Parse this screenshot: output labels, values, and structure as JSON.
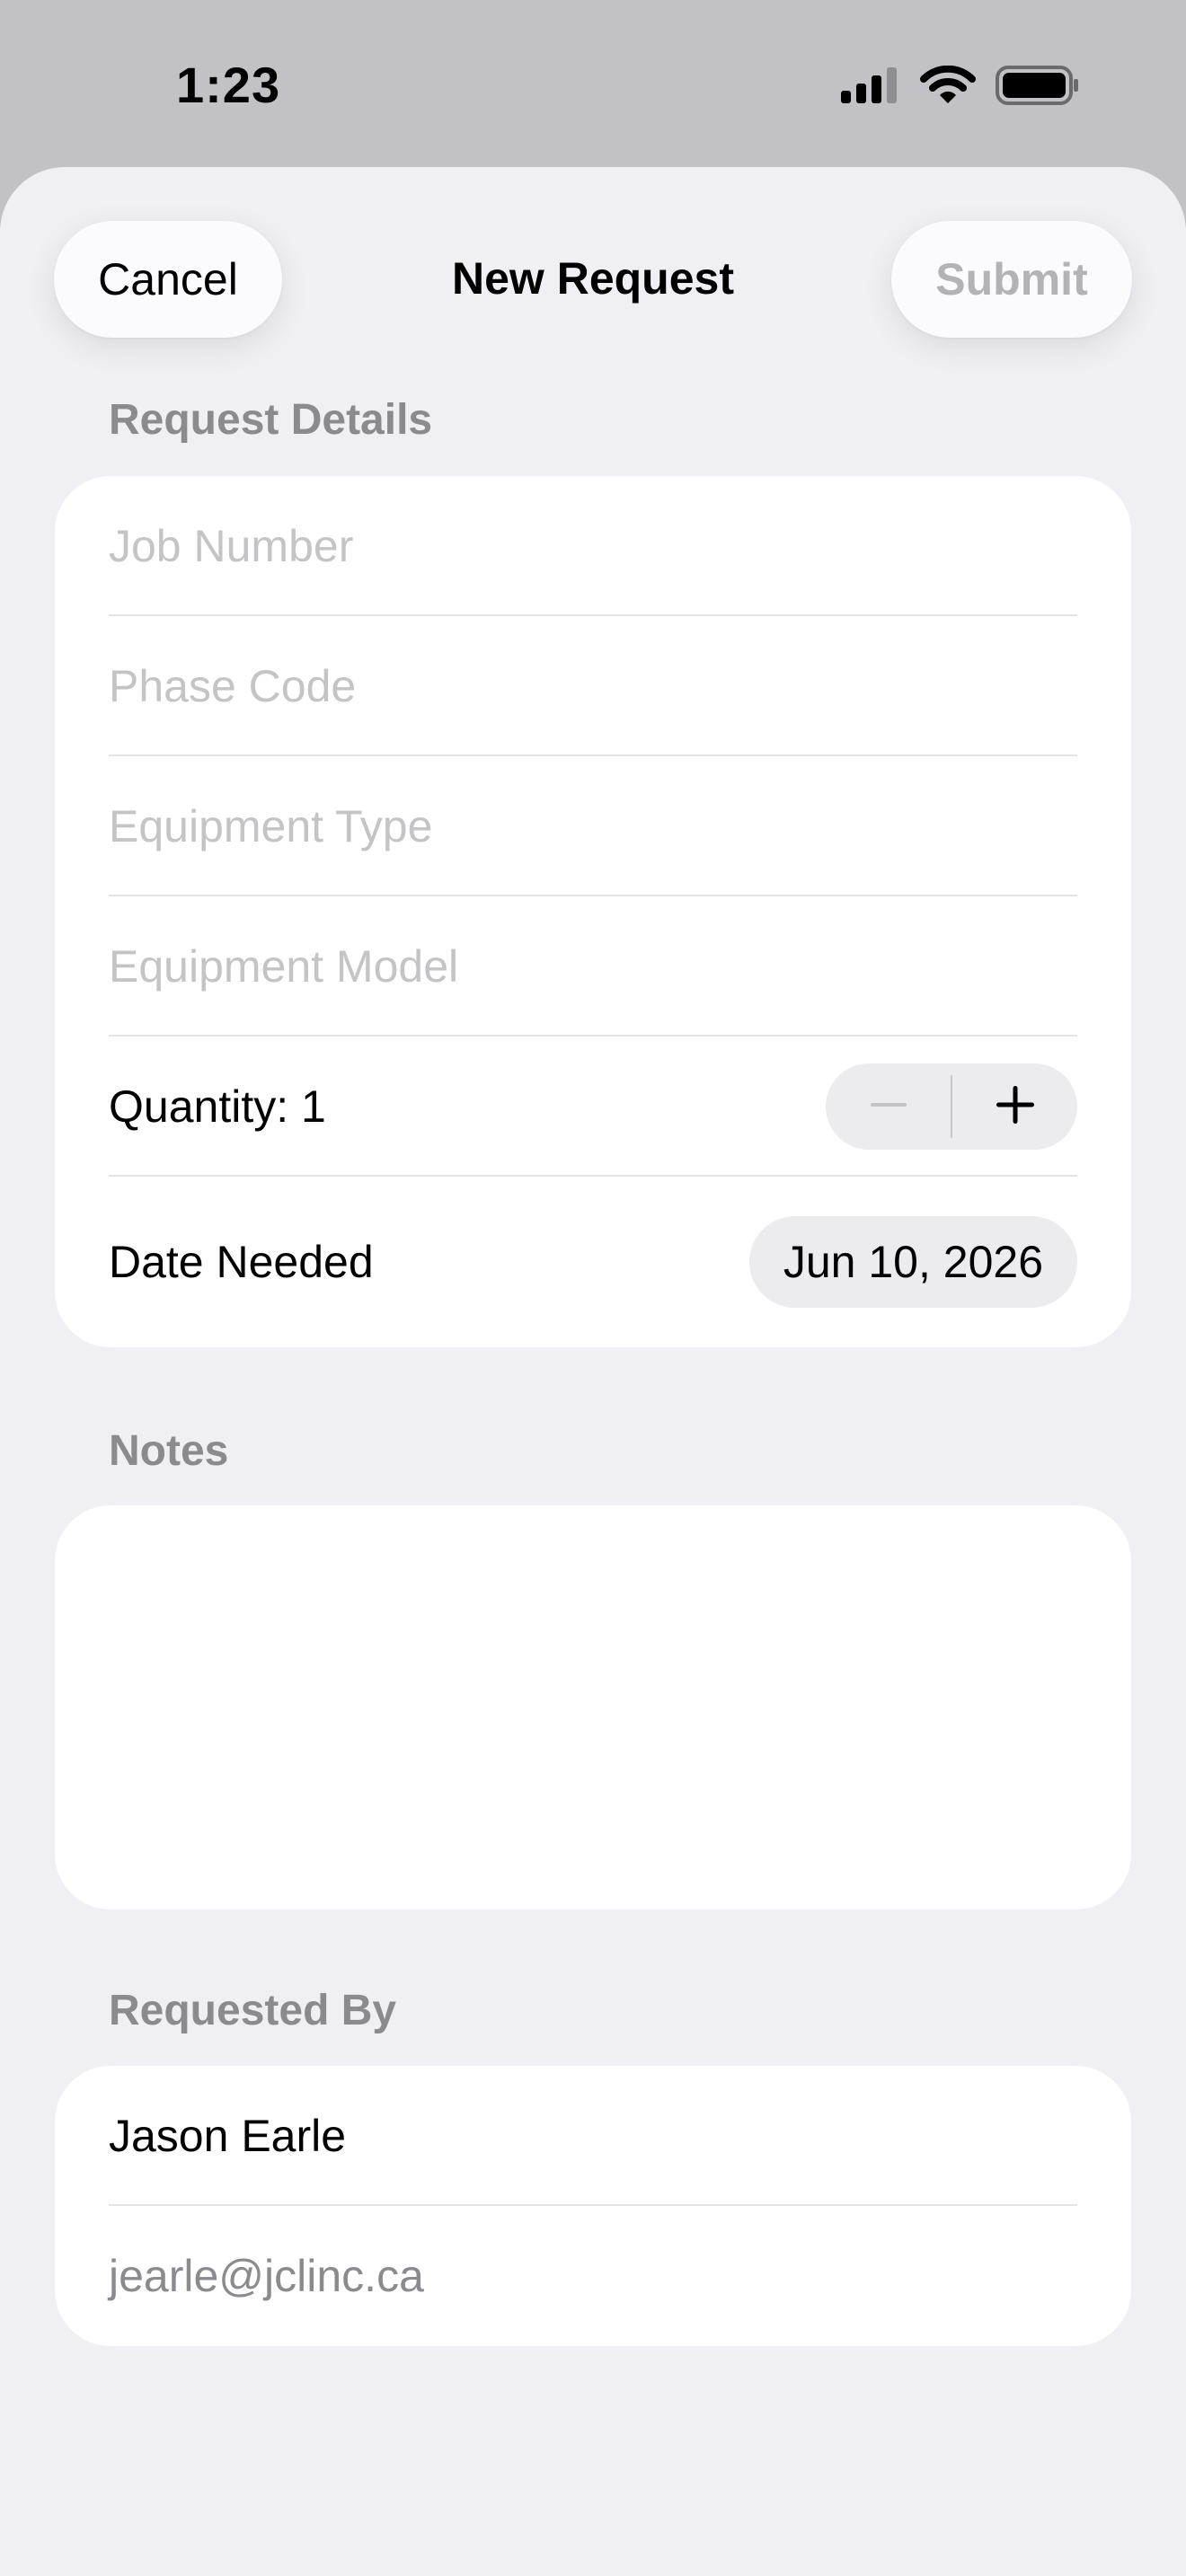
{
  "status_bar": {
    "time": "1:23",
    "icons": [
      "cellular-signal-icon",
      "wifi-icon",
      "battery-icon"
    ]
  },
  "nav": {
    "title": "New Request",
    "cancel_label": "Cancel",
    "submit_label": "Submit",
    "submit_enabled": false
  },
  "request_details": {
    "header": "Request Details",
    "fields": {
      "job_number": {
        "placeholder": "Job Number",
        "value": ""
      },
      "phase_code": {
        "placeholder": "Phase Code",
        "value": ""
      },
      "equipment_type": {
        "placeholder": "Equipment Type",
        "value": ""
      },
      "equipment_model": {
        "placeholder": "Equipment Model",
        "value": ""
      }
    },
    "quantity": {
      "label": "Quantity: 1",
      "value": 1,
      "decrement_enabled": false,
      "increment_enabled": true
    },
    "date_needed": {
      "label": "Date Needed",
      "value": "Jun 10, 2026"
    }
  },
  "notes": {
    "header": "Notes",
    "value": ""
  },
  "requested_by": {
    "header": "Requested By",
    "name": "Jason Earle",
    "email": "jearle@jclinc.ca"
  },
  "colors": {
    "sheet_background": "#f0eff4",
    "card_background": "#ffffff",
    "section_header": "#8a8a8f",
    "placeholder": "#c4c4c7",
    "disabled": "#b3b3b7",
    "dim_backdrop": "#c2c1c6"
  }
}
